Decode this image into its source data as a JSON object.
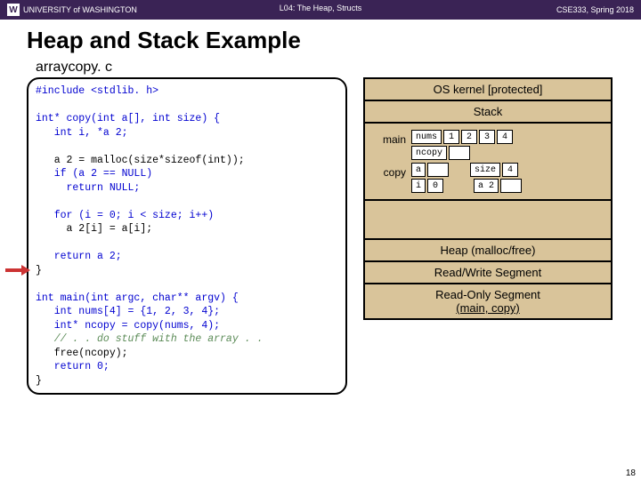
{
  "header": {
    "university": "UNIVERSITY of WASHINGTON",
    "lecture": "L04: The Heap, Structs",
    "course": "CSE333, Spring 2018"
  },
  "title": "Heap and Stack Example",
  "file_label": "arraycopy. c",
  "code": {
    "line_include": "#include <stdlib. h>",
    "line_sig": "int* copy(int a[], int size) {",
    "line_decl": "   int i, *a 2;",
    "line_malloc": "   a 2 = malloc(size*sizeof(int));",
    "line_if": "   if (a 2 == NULL)",
    "line_retnull": "     return NULL;",
    "line_for": "   for (i = 0; i < size; i++)",
    "line_assign": "     a 2[i] = a[i];",
    "line_reta2": "   return a 2;",
    "line_close1": "}",
    "line_main_sig": "int main(int argc, char** argv) {",
    "line_nums": "   int nums[4] = {1, 2, 3, 4};",
    "line_ncopy": "   int* ncopy = copy(nums, 4);",
    "line_comment": "   // . . do stuff with the array . .",
    "line_free": "   free(ncopy);",
    "line_ret0": "   return 0;",
    "line_close2": "}"
  },
  "memory": {
    "kernel": "OS kernel [protected]",
    "stack_label": "Stack",
    "heap": "Heap (malloc/free)",
    "rw": "Read/Write Segment",
    "ro_line1": "Read-Only Segment",
    "ro_line2": "(main, copy)",
    "main_label": "main",
    "copy_label": "copy",
    "nums_lbl": "nums",
    "n1": "1",
    "n2": "2",
    "n3": "3",
    "n4": "4",
    "ncopy_lbl": "ncopy",
    "a_lbl": "a",
    "size_lbl": "size",
    "size_val": "4",
    "i_lbl": "i",
    "i_val": "0",
    "a2_lbl": "a 2"
  },
  "page_number": "18"
}
